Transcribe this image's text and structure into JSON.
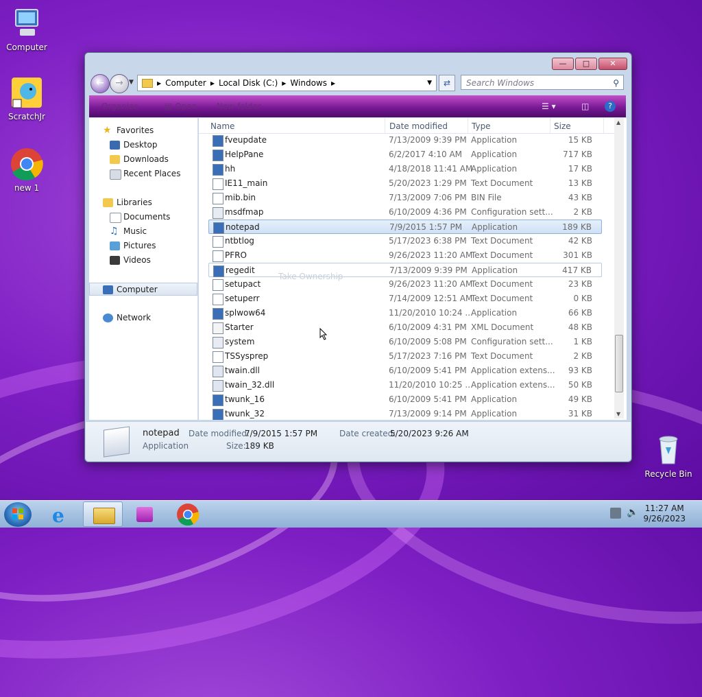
{
  "desktop": {
    "icons": [
      {
        "label": "Computer"
      },
      {
        "label": "ScratchJr"
      },
      {
        "label": "new 1"
      },
      {
        "label": "Recycle Bin"
      }
    ]
  },
  "explorer": {
    "breadcrumb": [
      "Computer",
      "Local Disk (C:)",
      "Windows"
    ],
    "search_placeholder": "Search Windows",
    "toolbar": {
      "organize": "Organize",
      "open": "Open",
      "new_folder": "New folder"
    },
    "nav": {
      "favorites": "Favorites",
      "favorites_items": [
        "Desktop",
        "Downloads",
        "Recent Places"
      ],
      "libraries": "Libraries",
      "libraries_items": [
        "Documents",
        "Music",
        "Pictures",
        "Videos"
      ],
      "computer": "Computer",
      "network": "Network"
    },
    "columns": {
      "name": "Name",
      "date": "Date modified",
      "type": "Type",
      "size": "Size"
    },
    "files": [
      {
        "name": "fveupdate",
        "date": "7/13/2009 9:39 PM",
        "type": "Application",
        "size": "15 KB"
      },
      {
        "name": "HelpPane",
        "date": "6/2/2017 4:10 AM",
        "type": "Application",
        "size": "717 KB"
      },
      {
        "name": "hh",
        "date": "4/18/2018 11:41 AM",
        "type": "Application",
        "size": "17 KB"
      },
      {
        "name": "IE11_main",
        "date": "5/20/2023 1:29 PM",
        "type": "Text Document",
        "size": "13 KB"
      },
      {
        "name": "mib.bin",
        "date": "7/13/2009 7:06 PM",
        "type": "BIN File",
        "size": "43 KB"
      },
      {
        "name": "msdfmap",
        "date": "6/10/2009 4:36 PM",
        "type": "Configuration sett...",
        "size": "2 KB"
      },
      {
        "name": "notepad",
        "date": "7/9/2015 1:57 PM",
        "type": "Application",
        "size": "189 KB"
      },
      {
        "name": "ntbtlog",
        "date": "5/17/2023 6:38 PM",
        "type": "Text Document",
        "size": "42 KB"
      },
      {
        "name": "PFRO",
        "date": "9/26/2023 11:20 AM",
        "type": "Text Document",
        "size": "301 KB"
      },
      {
        "name": "regedit",
        "date": "7/13/2009 9:39 PM",
        "type": "Application",
        "size": "417 KB"
      },
      {
        "name": "setupact",
        "date": "9/26/2023 11:20 AM",
        "type": "Text Document",
        "size": "23 KB"
      },
      {
        "name": "setuperr",
        "date": "7/14/2009 12:51 AM",
        "type": "Text Document",
        "size": "0 KB"
      },
      {
        "name": "splwow64",
        "date": "11/20/2010 10:24 ...",
        "type": "Application",
        "size": "66 KB"
      },
      {
        "name": "Starter",
        "date": "6/10/2009 4:31 PM",
        "type": "XML Document",
        "size": "48 KB"
      },
      {
        "name": "system",
        "date": "6/10/2009 5:08 PM",
        "type": "Configuration sett...",
        "size": "1 KB"
      },
      {
        "name": "TSSysprep",
        "date": "5/17/2023 7:16 PM",
        "type": "Text Document",
        "size": "2 KB"
      },
      {
        "name": "twain.dll",
        "date": "6/10/2009 5:41 PM",
        "type": "Application extens...",
        "size": "93 KB"
      },
      {
        "name": "twain_32.dll",
        "date": "11/20/2010 10:25 ...",
        "type": "Application extens...",
        "size": "50 KB"
      },
      {
        "name": "twunk_16",
        "date": "6/10/2009 5:41 PM",
        "type": "Application",
        "size": "49 KB"
      },
      {
        "name": "twunk_32",
        "date": "7/13/2009 9:14 PM",
        "type": "Application",
        "size": "31 KB"
      }
    ],
    "ghost_tooltip": "Take Ownership",
    "details": {
      "name": "notepad",
      "kind": "Application",
      "date_modified_label": "Date modified:",
      "date_modified": "7/9/2015 1:57 PM",
      "date_created_label": "Date created:",
      "date_created": "5/20/2023 9:26 AM",
      "size_label": "Size:",
      "size": "189 KB"
    }
  },
  "taskbar": {
    "time": "11:27 AM",
    "date": "9/26/2023"
  }
}
